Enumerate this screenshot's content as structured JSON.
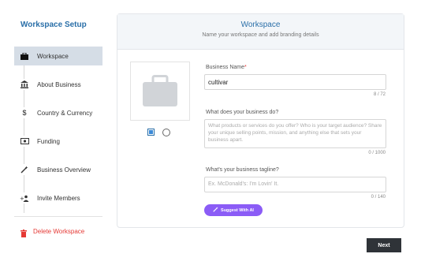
{
  "sidebar": {
    "title": "Workspace Setup",
    "items": [
      {
        "label": "Workspace",
        "icon": "briefcase-icon",
        "active": true
      },
      {
        "label": "About Business",
        "icon": "bank-icon"
      },
      {
        "label": "Country & Currency",
        "icon": "dollar-icon"
      },
      {
        "label": "Funding",
        "icon": "money-icon"
      },
      {
        "label": "Business Overview",
        "icon": "magic-wand-icon"
      },
      {
        "label": "Invite Members",
        "icon": "add-user-icon"
      }
    ],
    "delete_label": "Delete Workspace"
  },
  "card": {
    "title": "Workspace",
    "subtitle": "Name your workspace and add branding details"
  },
  "form": {
    "business_name": {
      "label": "Business Name",
      "required_mark": "*",
      "value": "cultivar",
      "counter": "8 / 72"
    },
    "description": {
      "label": "What does your business do?",
      "placeholder": "What products or services do you offer? Who is your target audience? Share your unique selling points, mission, and anything else that sets your business apart.",
      "counter": "0 / 1000"
    },
    "tagline": {
      "label": "What's your business tagline?",
      "placeholder": "Ex. McDonald's: I'm Lovin' It.",
      "counter": "0 / 140"
    },
    "ai_button": "Suggest With AI"
  },
  "footer": {
    "next_label": "Next"
  },
  "colors": {
    "accent": "#2a6fa8",
    "active_bg": "#d5dde6",
    "danger": "#e53935",
    "ai": "#8b5cf6",
    "dark_button": "#2f3338"
  }
}
